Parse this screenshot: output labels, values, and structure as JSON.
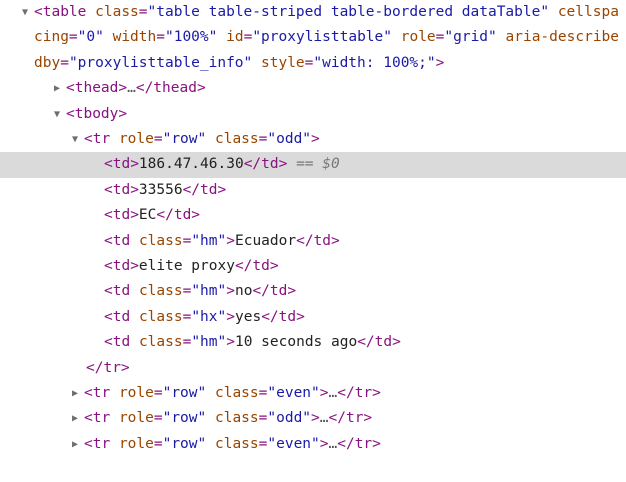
{
  "dom_tree": {
    "table_open": {
      "open": "<",
      "tag": "table",
      "attrs": [
        {
          "name": "class",
          "value": "\"table table-striped table-bordered dataTable\""
        },
        {
          "name": "cellspacing",
          "value": "\"0\""
        },
        {
          "name": "width",
          "value": "\"100%\""
        },
        {
          "name": "id",
          "value": "\"proxylisttable\""
        },
        {
          "name": "role",
          "value": "\"grid\""
        },
        {
          "name": "aria-describedby",
          "value": "\"proxylisttable_info\""
        },
        {
          "name": "style",
          "value": "\"width: 100%;\""
        }
      ],
      "close": ">"
    },
    "thead": {
      "open": "<thead>",
      "ellipsis": "…",
      "close": "</thead>"
    },
    "tbody": {
      "open": "<tbody>"
    },
    "tr_open": {
      "open": "<tr",
      "attrs": [
        {
          "name": "role",
          "value": "\"row\""
        },
        {
          "name": "class",
          "value": "\"odd\""
        }
      ],
      "close": ">"
    },
    "cells": [
      {
        "open": "<td>",
        "text": "186.47.46.30",
        "close": "</td>",
        "selected": true
      },
      {
        "open": "<td>",
        "text": "33556",
        "close": "</td>"
      },
      {
        "open": "<td>",
        "text": "EC",
        "close": "</td>"
      },
      {
        "open": "<td",
        "attr_name": "class",
        "attr_val": "\"hm\"",
        "gt": ">",
        "text": "Ecuador",
        "close": "</td>"
      },
      {
        "open": "<td>",
        "text": "elite proxy",
        "close": "</td>"
      },
      {
        "open": "<td",
        "attr_name": "class",
        "attr_val": "\"hm\"",
        "gt": ">",
        "text": "no",
        "close": "</td>"
      },
      {
        "open": "<td",
        "attr_name": "class",
        "attr_val": "\"hx\"",
        "gt": ">",
        "text": "yes",
        "close": "</td>"
      },
      {
        "open": "<td",
        "attr_name": "class",
        "attr_val": "\"hm\"",
        "gt": ">",
        "text": "10 seconds ago",
        "close": "</td>"
      }
    ],
    "selected_marker": "== $0",
    "tr_close": "</tr>",
    "collapsed_rows": [
      {
        "open": "<tr",
        "role_name": "role",
        "role_val": "\"row\"",
        "class_name": "class",
        "class_val": "\"even\"",
        "gt": ">",
        "ellipsis": "…",
        "close": "</tr>"
      },
      {
        "open": "<tr",
        "role_name": "role",
        "role_val": "\"row\"",
        "class_name": "class",
        "class_val": "\"odd\"",
        "gt": ">",
        "ellipsis": "…",
        "close": "</tr>"
      },
      {
        "open": "<tr",
        "role_name": "role",
        "role_val": "\"row\"",
        "class_name": "class",
        "class_val": "\"even\"",
        "gt": ">",
        "ellipsis": "…",
        "close": "</tr>"
      }
    ],
    "icons": {
      "expanded": "▼",
      "collapsed": "▶"
    }
  }
}
